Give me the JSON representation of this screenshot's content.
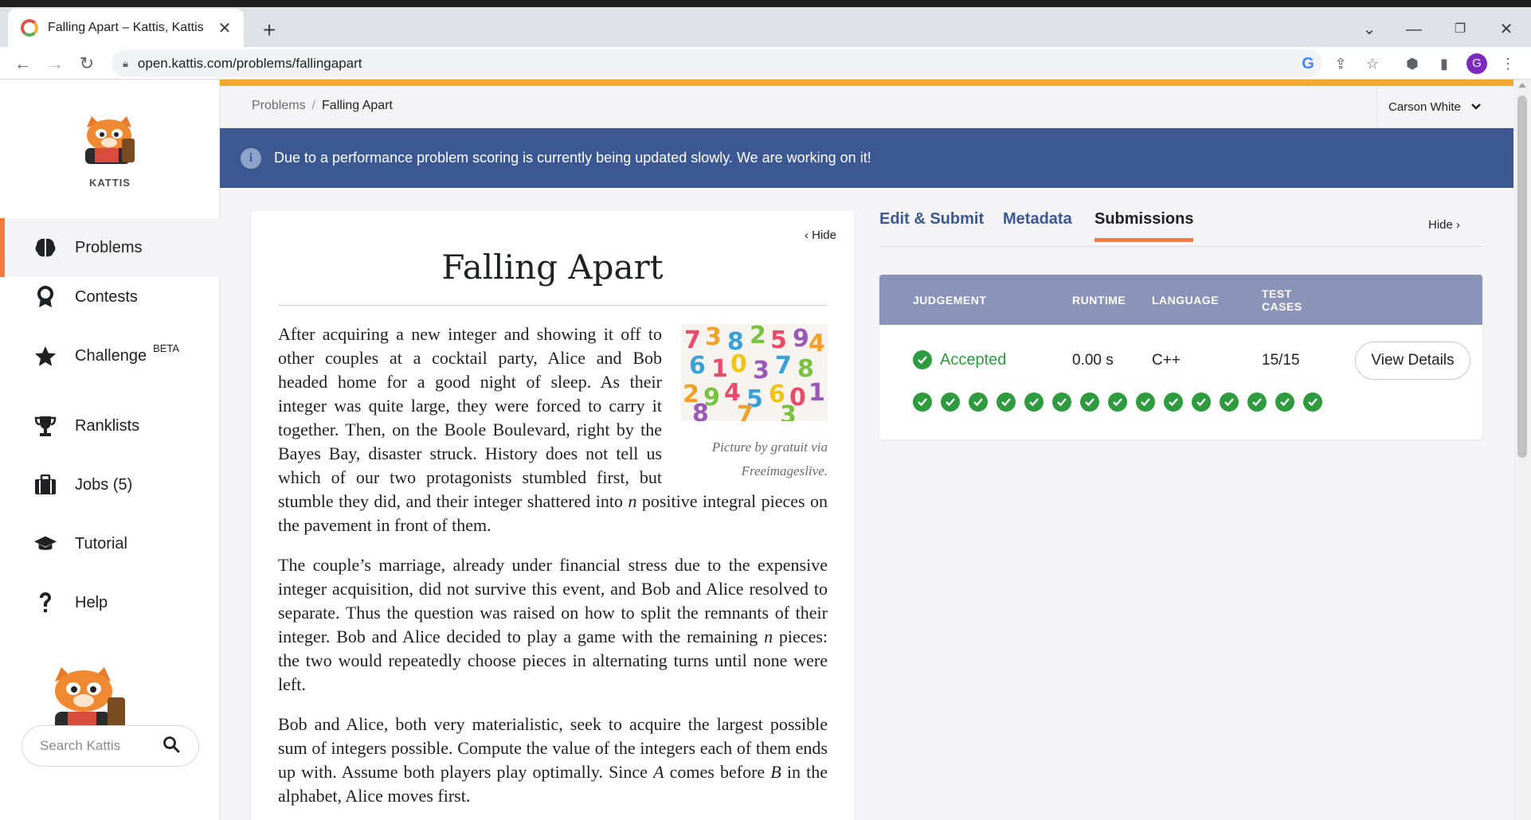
{
  "browser": {
    "tab_title": "Falling Apart – Kattis, Kattis",
    "tab_close": "✕",
    "new_tab": "+",
    "url": "open.kattis.com/problems/fallingapart",
    "profile_initial": "G"
  },
  "sidebar": {
    "logo_text": "KATTIS",
    "items": [
      {
        "label": "Problems",
        "icon": "brain-icon"
      },
      {
        "label": "Contests",
        "icon": "medal-icon"
      },
      {
        "label": "Challenge",
        "sup": "BETA",
        "icon": "star-icon"
      },
      {
        "label": "Ranklists",
        "icon": "trophy-icon"
      },
      {
        "label": "Jobs (5)",
        "icon": "briefcase-icon"
      },
      {
        "label": "Tutorial",
        "icon": "graduation-cap-icon"
      },
      {
        "label": "Help",
        "icon": "question-icon"
      }
    ],
    "search_placeholder": "Search Kattis"
  },
  "header": {
    "breadcrumb_root": "Problems",
    "breadcrumb_sep": "/",
    "breadcrumb_current": "Falling Apart",
    "user": "Carson White"
  },
  "notice": {
    "message": "Due to a performance problem scoring is currently being updated slowly. We are working on it!"
  },
  "problem": {
    "hide_label": "Hide",
    "title": "Falling Apart",
    "caption": "Picture by gratuit via Freeimageslive.",
    "p1": "After acquiring a new integer and showing it off to other couples at a cocktail party, Alice and Bob headed home for a good night of sleep. As their integer was quite large, they were forced to carry it together. Then, on the Boole Boulevard, right by the Bayes Bay, disaster struck. History does not tell us which of our two protagonists stumbled first, but stumble they did, and their integer shattered into",
    "p1_var": "n",
    "p1_end": "positive integral pieces on the pavement in front of them.",
    "p2_a": "The couple’s marriage, already under financial stress due to the expensive integer acquisition, did not survive this event, and Bob and Alice resolved to separate. Thus the question was raised on how to split the remnants of their integer. Bob and Alice decided to play a game with the remaining",
    "p2_var": "n",
    "p2_b": "pieces: the two would repeatedly choose pieces in alternating turns until none were left.",
    "p3_a": "Bob and Alice, both very materialistic, seek to acquire the largest possible sum of integers possible. Compute the value of the integers each of them ends up with. Assume both players play optimally. Since",
    "p3_var_a": "A",
    "p3_mid": "comes before",
    "p3_var_b": "B",
    "p3_end": "in the alphabet, Alice moves first."
  },
  "panel": {
    "tabs": [
      "Edit & Submit",
      "Metadata",
      "Submissions"
    ],
    "active_tab": "Submissions",
    "hide_label": "Hide",
    "columns": {
      "judgement": "JUDGEMENT",
      "runtime": "RUNTIME",
      "language": "LANGUAGE",
      "test_cases_1": "TEST",
      "test_cases_2": "CASES"
    },
    "submission": {
      "judgement": "Accepted",
      "runtime": "0.00 s",
      "language": "C++",
      "test_cases": "15/15",
      "passed_count": 15,
      "view_details": "View Details"
    }
  },
  "colors": {
    "accent_orange": "#f5793b",
    "notice_blue": "#3b5893",
    "accepted_green": "#2e9b3f",
    "top_bar_yellow": "#f3a92b"
  }
}
